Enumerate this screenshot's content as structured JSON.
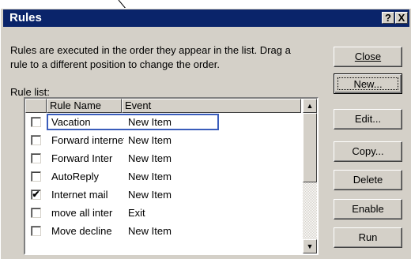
{
  "window": {
    "title": "Rules",
    "help_label": "?",
    "close_label": "X"
  },
  "description": {
    "line1": "Rules are executed in the order they appear in the list.  Drag a",
    "line2": "rule to a different position to change the order."
  },
  "rule_list_label": "Rule list:",
  "columns": [
    "Rule Name",
    "Event"
  ],
  "rules": [
    {
      "name": "Vacation",
      "event": "New Item",
      "checked": false
    },
    {
      "name": "Forward internet",
      "event": "New Item",
      "checked": false
    },
    {
      "name": "Forward Inter",
      "event": "New Item",
      "checked": false
    },
    {
      "name": "AutoReply",
      "event": "New Item",
      "checked": false
    },
    {
      "name": "Internet mail",
      "event": "New Item",
      "checked": true
    },
    {
      "name": "move all inter",
      "event": "Exit",
      "checked": false
    },
    {
      "name": "Move decline",
      "event": "New Item",
      "checked": false
    }
  ],
  "scrollbar": {
    "up_arrow": "▲",
    "down_arrow": "▼"
  },
  "buttons": {
    "close": "Close",
    "new": "New...",
    "edit": "Edit...",
    "copy": "Copy...",
    "delete": "Delete",
    "enable": "Enable",
    "run": "Run"
  },
  "colors": {
    "title_bar": "#0a246a",
    "face": "#d4d0c8",
    "focus_outline": "#3a5dbb"
  }
}
